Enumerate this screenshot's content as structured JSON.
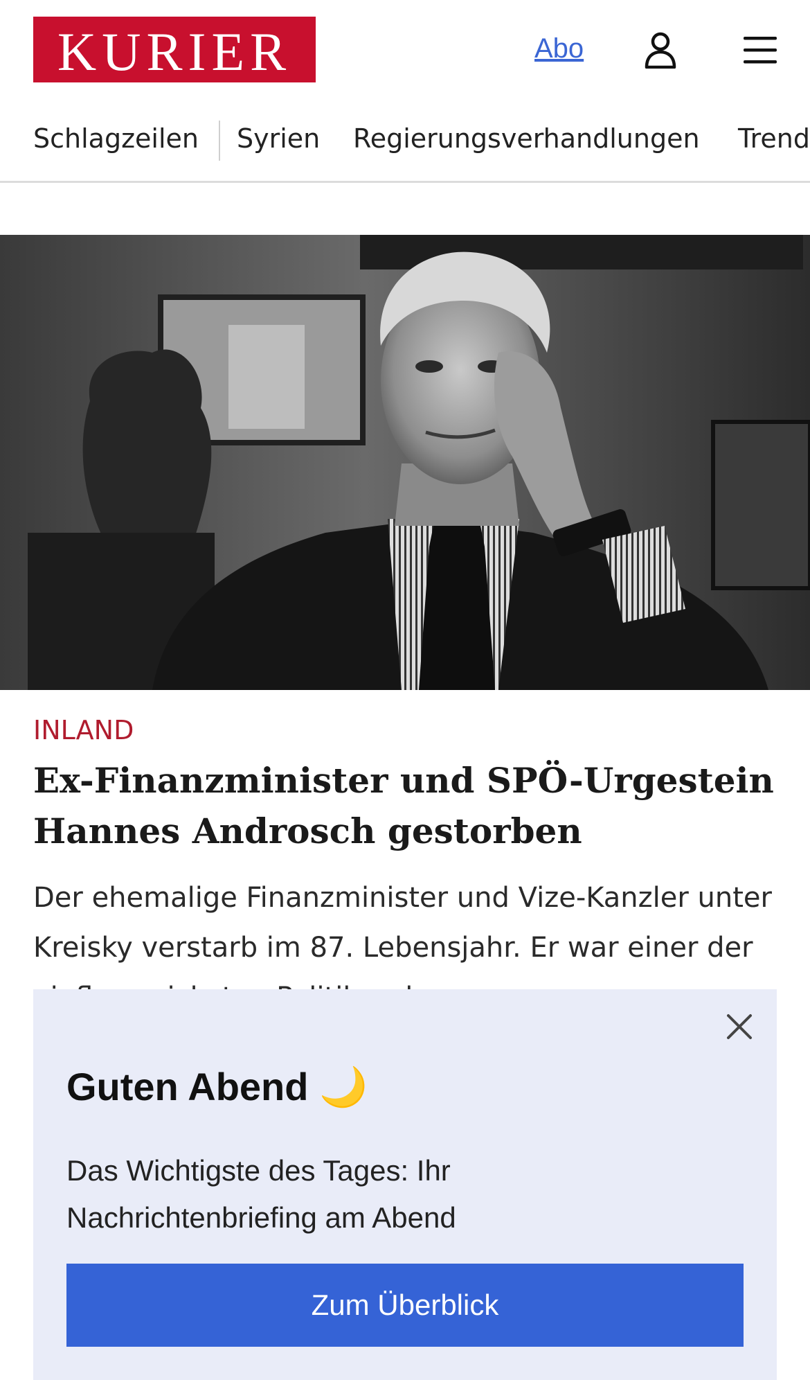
{
  "header": {
    "logo_text": "KURIER",
    "abo_label": "Abo",
    "user_icon": "user-icon",
    "menu_icon": "hamburger-menu-icon"
  },
  "nav": {
    "items": [
      {
        "label": "Schlagzeilen"
      },
      {
        "label": "Syrien"
      },
      {
        "label": "Regierungsverhandlungen"
      },
      {
        "label": "Trend"
      }
    ]
  },
  "article": {
    "category": "INLAND",
    "headline": "Ex-Finanzminister und SPÖ-Urgestein Hannes Androsch gestorben",
    "teaser": "Der ehemalige Finanzminister und Vize-Kanzler unter Kreisky verstarb im 87. Lebensjahr. Er war einer der einflussreichsten Politiker der"
  },
  "popup": {
    "title": "Guten Abend 🌙",
    "text": "Das Wichtigste des Tages: Ihr Nachrichtenbriefing am Abend",
    "cta_label": "Zum Überblick",
    "close_icon": "close-icon"
  },
  "colors": {
    "brand_red": "#c8102e",
    "category_red": "#b01c2e",
    "link_blue": "#3b66d4",
    "cta_blue": "#3563d6",
    "popup_bg": "#e9ecf8"
  }
}
